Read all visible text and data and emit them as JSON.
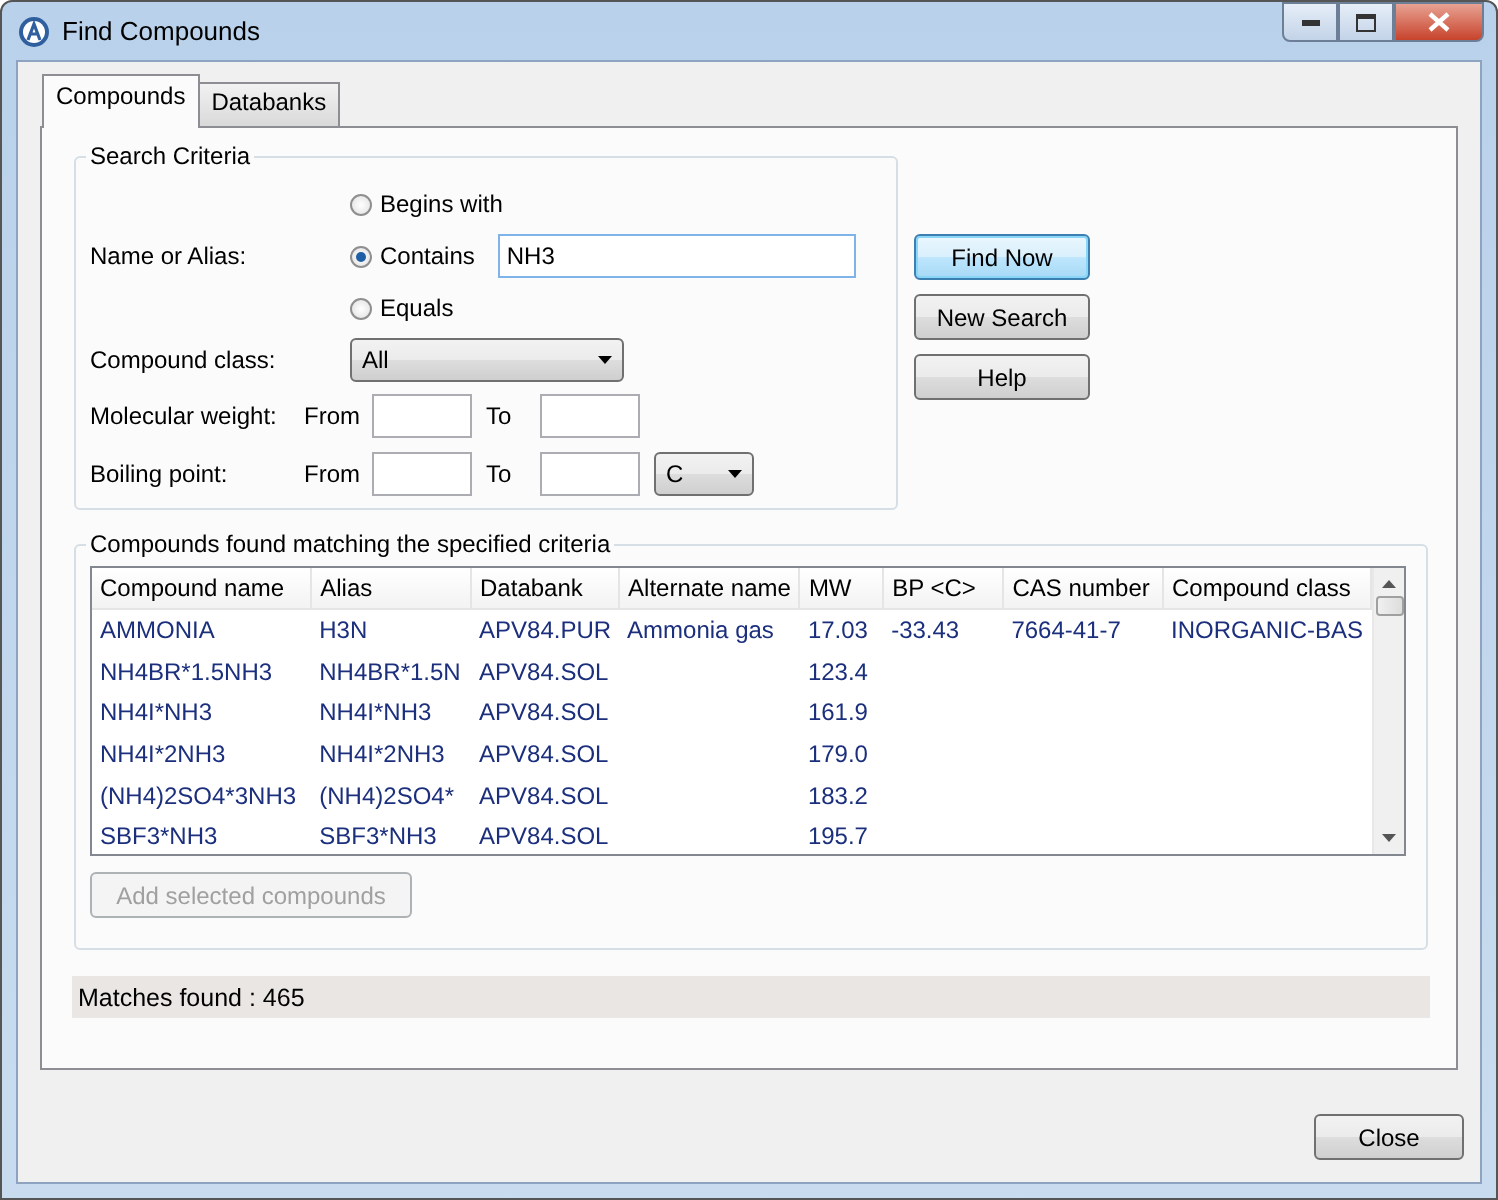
{
  "window": {
    "title": "Find Compounds"
  },
  "tabs": [
    {
      "label": "Compounds",
      "selected": true
    },
    {
      "label": "Databanks",
      "selected": false
    }
  ],
  "search_criteria": {
    "title": "Search Criteria",
    "name_label": "Name or Alias:",
    "match_options": [
      {
        "label": "Begins with",
        "selected": false
      },
      {
        "label": "Contains",
        "selected": true
      },
      {
        "label": "Equals",
        "selected": false
      }
    ],
    "name_value": "NH3",
    "compound_class_label": "Compound class:",
    "compound_class": "All",
    "mw_label": "Molecular weight:",
    "mw_from_label": "From",
    "mw_to_label": "To",
    "bp_label": "Boiling point:",
    "bp_from_label": "From",
    "bp_to_label": "To",
    "bp_unit": "C"
  },
  "buttons": [
    {
      "label": "Find Now",
      "focused": true
    },
    {
      "label": "New Search",
      "focused": false
    },
    {
      "label": "Help",
      "focused": false
    }
  ],
  "results": {
    "title": "Compounds found matching the specified criteria",
    "columns": [
      "Compound name",
      "Alias",
      "Databank",
      "Alternate name",
      "MW",
      "BP <C>",
      "CAS number",
      "Compound class"
    ],
    "rows": [
      {
        "compound_name": "AMMONIA",
        "alias": "H3N",
        "databank": "APV84.PUR",
        "alternate_name": "Ammonia gas",
        "mw": "17.03",
        "bp": "-33.43",
        "cas_number": "7664-41-7",
        "compound_class": "INORGANIC-BAS"
      },
      {
        "compound_name": "NH4BR*1.5NH3",
        "alias": "NH4BR*1.5N",
        "databank": "APV84.SOL",
        "mw": "123.4"
      },
      {
        "compound_name": "NH4I*NH3",
        "alias": "NH4I*NH3",
        "databank": "APV84.SOL",
        "mw": "161.9"
      },
      {
        "compound_name": "NH4I*2NH3",
        "alias": "NH4I*2NH3",
        "databank": "APV84.SOL",
        "mw": "179.0"
      },
      {
        "compound_name": "(NH4)2SO4*3NH3",
        "alias": "(NH4)2SO4*",
        "databank": "APV84.SOL",
        "mw": "183.2"
      },
      {
        "compound_name": "SBF3*NH3",
        "alias": "SBF3*NH3",
        "databank": "APV84.SOL",
        "mw": "195.7"
      }
    ],
    "add_button": {
      "label": "Add selected compounds",
      "disabled": true
    }
  },
  "status": "Matches found : 465",
  "close_button": {
    "label": "Close"
  }
}
